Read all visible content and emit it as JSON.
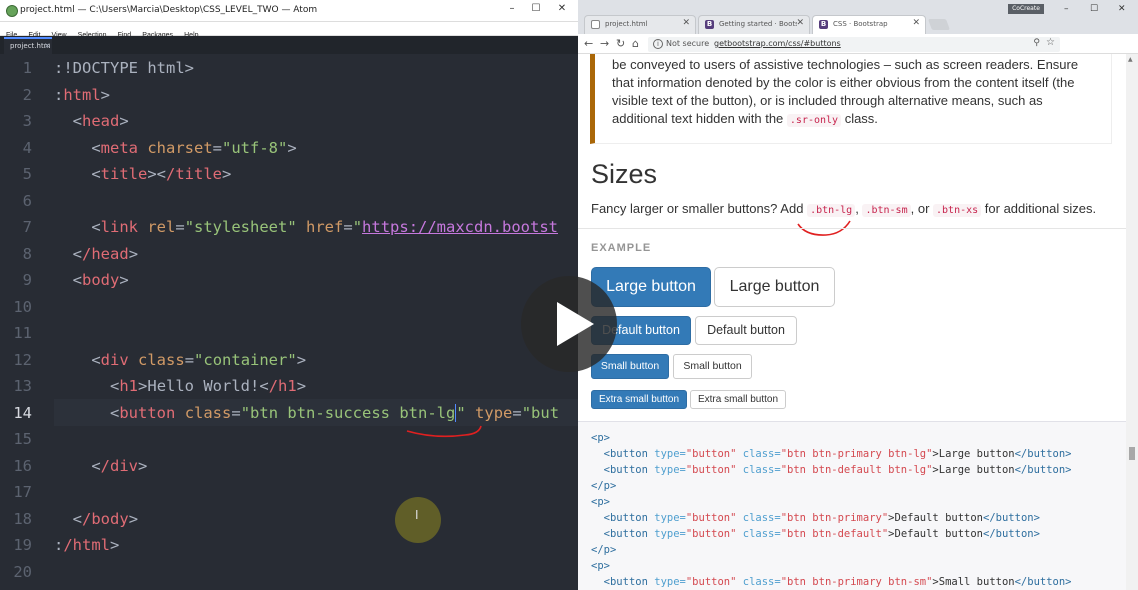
{
  "atom": {
    "window_title": "project.html — C:\\Users\\Marcia\\Desktop\\CSS_LEVEL_TWO — Atom",
    "menu": [
      "File",
      "Edit",
      "View",
      "Selection",
      "Find",
      "Packages",
      "Help"
    ],
    "tab_label": "project.htm",
    "line_numbers": [
      "1",
      "2",
      "3",
      "4",
      "5",
      "6",
      "7",
      "8",
      "9",
      "10",
      "11",
      "12",
      "13",
      "14",
      "15",
      "16",
      "17",
      "18",
      "19",
      "20"
    ],
    "current_line": "14",
    "code": {
      "l1": ":!DOCTYPE html>",
      "l2_open": ":",
      "l2_tag": "html",
      "l3_tag": "head",
      "l4_tag": "meta",
      "l4_attr": "charset",
      "l4_val": "\"utf-8\"",
      "l5_a": "title",
      "l5_b": "/title",
      "l7_tag": "link",
      "l7_attr1": "rel",
      "l7_val1": "\"stylesheet\"",
      "l7_attr2": "href",
      "l7_url": "https://maxcdn.bootst",
      "l8_tag": "/head",
      "l9_tag": "body",
      "l12_tag": "div",
      "l12_attr": "class",
      "l12_val": "\"container\"",
      "l13_tag1": "h1",
      "l13_text": "Hello World!",
      "l13_tag2": "/h1",
      "l14_tag": "button",
      "l14_attr": "class",
      "l14_val": "\"btn btn-success btn-lg",
      "l14_val_end": "\"",
      "l14_attr2": "type",
      "l14_val2": "\"but",
      "l16_tag": "/div",
      "l18_tag": "/body",
      "l19_open": ":",
      "l19_tag": "/html"
    },
    "cursor_glyph": "I"
  },
  "chrome": {
    "tabs": [
      {
        "title": "project.html",
        "favicon": ""
      },
      {
        "title": "Getting started · Bootstr",
        "favicon": "B"
      },
      {
        "title": "CSS · Bootstrap",
        "favicon": "B"
      }
    ],
    "user_badge": "CoCreate",
    "address": {
      "security": "Not secure",
      "url": "getbootstrap.com/css/#buttons"
    },
    "callout_text_before": "be conveyed to users of assistive technologies – such as screen readers. Ensure that information denoted by the color is either obvious from the content itself (the visible text of the button), or is included through alternative means, such as additional text hidden with the ",
    "callout_code": ".sr-only",
    "callout_text_after": " class.",
    "sizes_heading": "Sizes",
    "sizes_intro_before": "Fancy larger or smaller buttons? Add ",
    "code_lg": ".btn-lg",
    "code_sm": ".btn-sm",
    "code_xs": ".btn-xs",
    "sizes_intro_sep1": ", ",
    "sizes_intro_sep2": ", or ",
    "sizes_intro_after": " for additional sizes.",
    "example_label": "EXAMPLE",
    "buttons": {
      "lg_primary": "Large button",
      "lg_default": "Large button",
      "md_primary": "Default button",
      "md_default": "Default button",
      "sm_primary": "Small button",
      "sm_default": "Small button",
      "xs_primary": "Extra small button",
      "xs_default": "Extra small button"
    },
    "snippet": [
      {
        "k": "p_open",
        "text": "<p>"
      },
      {
        "k": "btn",
        "cls": "\"btn btn-primary btn-lg\"",
        "label": "Large button"
      },
      {
        "k": "btn",
        "cls": "\"btn btn-default btn-lg\"",
        "label": "Large button"
      },
      {
        "k": "p_close",
        "text": "</p>"
      },
      {
        "k": "p_open",
        "text": "<p>"
      },
      {
        "k": "btn",
        "cls": "\"btn btn-primary\"",
        "label": "Default button"
      },
      {
        "k": "btn",
        "cls": "\"btn btn-default\"",
        "label": "Default button"
      },
      {
        "k": "p_close",
        "text": "</p>"
      },
      {
        "k": "p_open",
        "text": "<p>"
      },
      {
        "k": "btn",
        "cls": "\"btn btn-primary btn-sm\"",
        "label": "Small button"
      }
    ]
  },
  "colors": {
    "atom_bg": "#282c34",
    "tag": "#e06c75",
    "attr": "#d19a66",
    "string": "#98c379",
    "bootstrap_primary": "#337ab7",
    "annotation_red": "#e02020"
  }
}
